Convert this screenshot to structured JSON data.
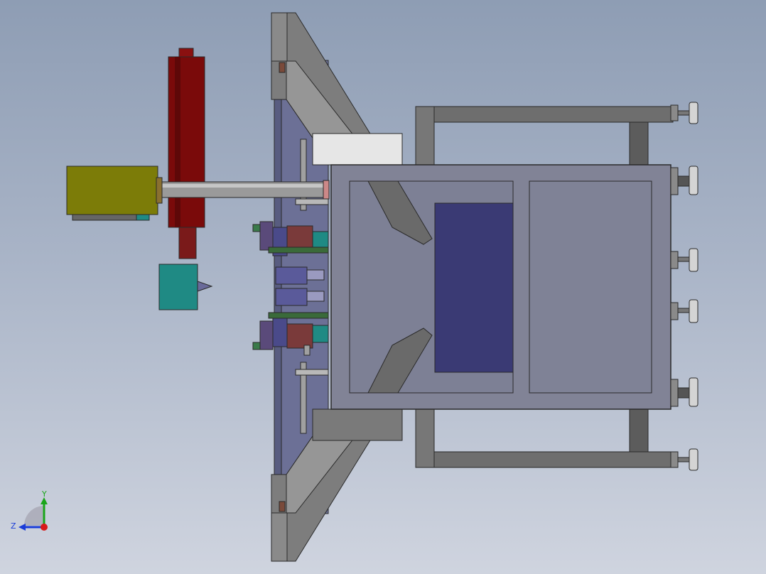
{
  "viewport": {
    "background_top": "#8e9db4",
    "background_bottom": "#cfd4df",
    "description_of_view": "cad-orthographic-view"
  },
  "triad": {
    "y_label": "Y",
    "z_label": "Z",
    "y_color": "#1aa51a",
    "z_color": "#1a3cd8",
    "x_color": "#d81a1a"
  },
  "colors": {
    "frame_gray": "#7a7a7a",
    "frame_dark": "#4e4e4e",
    "plate_blue": "#6c7096",
    "housing": "#818396",
    "window": "#3a3a74",
    "cylinder_red": "#7a0a0a",
    "motor_olive": "#7c7c08",
    "teal_box": "#1f8a84",
    "shaft": "#9a9a9a"
  }
}
